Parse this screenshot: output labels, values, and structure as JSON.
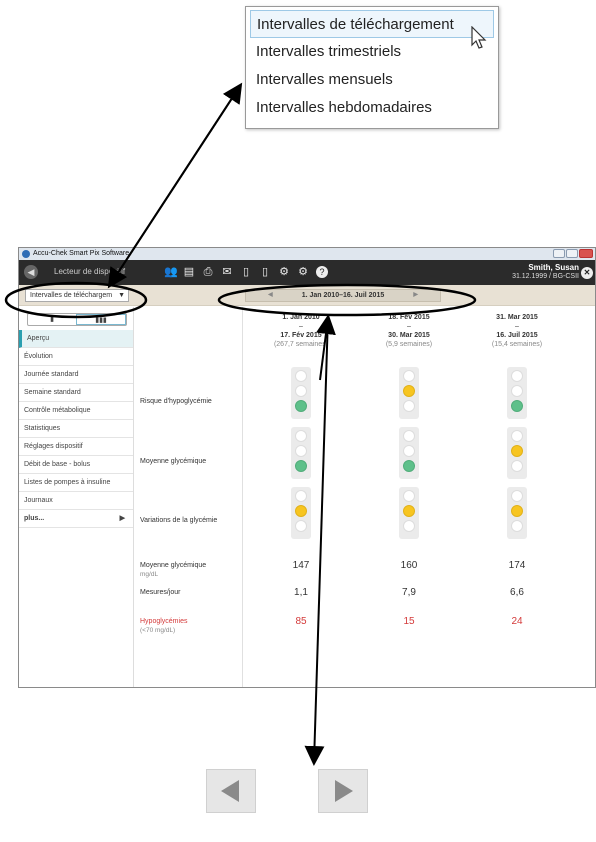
{
  "popup": {
    "items": [
      "Intervalles de téléchargement",
      "Intervalles trimestriels",
      "Intervalles mensuels",
      "Intervalles hebdomadaires"
    ],
    "highlighted_index": 0
  },
  "window": {
    "app_title": "Accu-Chek Smart Pix Software",
    "toolbar_title": "Lecteur de dispositif",
    "user_name": "Smith, Susan",
    "user_info": "31.12.1999 / BG-CSII",
    "toolbar_icons": [
      "users-icon",
      "save-icon",
      "print-icon",
      "mail-icon",
      "pdf-icon",
      "pdf-export-icon",
      "settings-icon",
      "device-settings-icon",
      "help-icon"
    ]
  },
  "filter": {
    "dropdown_value": "Intervalles de téléchargem",
    "range_label": "1. Jan 2010–16. Juil 2015"
  },
  "sidebar": {
    "items": [
      "Aperçu",
      "Évolution",
      "Journée standard",
      "Semaine standard",
      "Contrôle métabolique",
      "Statistiques",
      "Réglages dispositif",
      "Débit de base - bolus",
      "Listes de pompes à insuline",
      "Journaux"
    ],
    "more": "plus...",
    "active_index": 0
  },
  "rows": {
    "hypo_risk": "Risque d'hypoglycémie",
    "mean_glucose": "Moyenne glycémique",
    "variations": "Variations de la glycémie",
    "mean_value_label": "Moyenne glycémique",
    "mean_value_unit": "mg/dL",
    "measures_label": "Mesures/jour",
    "hypos_label": "Hypoglycémies",
    "hypos_unit": "(<70 mg/dL)"
  },
  "columns": [
    {
      "start": "1. Jan 2010",
      "dash": "–",
      "end": "17. Fév 2015",
      "weeks": "(267,7 semaines)",
      "hypo_light": "green",
      "mean_light": "green",
      "var_light": "yellow",
      "mean": "147",
      "measures": "1,1",
      "hypos": "85"
    },
    {
      "start": "18. Fév 2015",
      "dash": "–",
      "end": "30. Mar 2015",
      "weeks": "(5,9 semaines)",
      "hypo_light": "yellow",
      "mean_light": "green",
      "var_light": "yellow",
      "mean": "160",
      "measures": "7,9",
      "hypos": "15"
    },
    {
      "start": "31. Mar 2015",
      "dash": "–",
      "end": "16. Juil 2015",
      "weeks": "(15,4 semaines)",
      "hypo_light": "green",
      "mean_light": "yellow",
      "var_light": "yellow",
      "mean": "174",
      "measures": "6,6",
      "hypos": "24"
    }
  ],
  "bottom_nav": [
    "previous-arrow-icon",
    "next-arrow-icon"
  ]
}
